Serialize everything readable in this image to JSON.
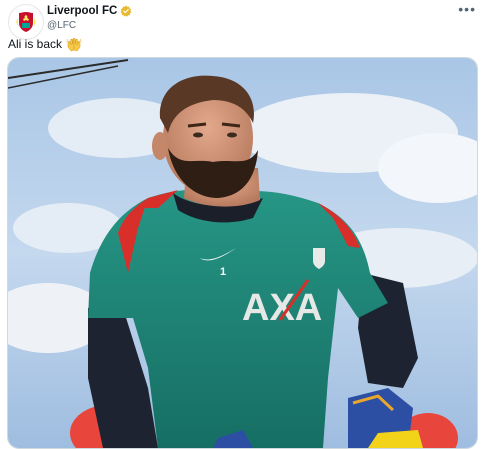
{
  "account": {
    "display_name": "Liverpool FC",
    "handle": "@LFC",
    "verified": true,
    "verified_color": "#e8b931",
    "avatar_icon": "liverpool-crest-icon"
  },
  "tweet": {
    "text": "Ali is back",
    "emoji": "raised-hands-emoji"
  },
  "media": {
    "description_icon": "goalkeeper-photo",
    "sponsor_logo": "AXA"
  },
  "menu_icon": "more-options-icon",
  "colors": {
    "text": "#0f1419",
    "secondary_text": "#536471",
    "shirt": "#1f8a7a",
    "shirt_trim": "#d92f2a"
  }
}
